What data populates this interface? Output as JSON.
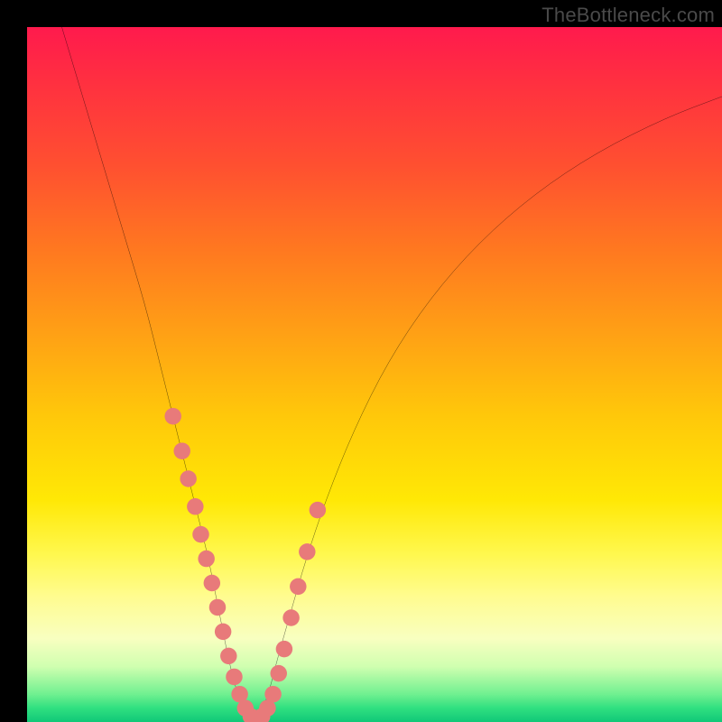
{
  "watermark": "TheBottleneck.com",
  "chart_data": {
    "type": "line",
    "title": "",
    "xlabel": "",
    "ylabel": "",
    "xlim": [
      0,
      100
    ],
    "ylim": [
      0,
      100
    ],
    "grid": false,
    "legend": false,
    "series": [
      {
        "name": "bottleneck-curve",
        "color": "#000000",
        "x": [
          5,
          8,
          11,
          14,
          17,
          19,
          21,
          23,
          24.5,
          26,
          27,
          28,
          29,
          30,
          31,
          32,
          33,
          34,
          35,
          36,
          38,
          40,
          43,
          47,
          52,
          58,
          65,
          73,
          82,
          92,
          100
        ],
        "y": [
          100,
          90,
          80,
          70,
          60,
          52,
          44,
          36,
          30,
          24,
          19,
          14,
          9,
          5,
          2,
          0.5,
          0.5,
          2,
          5,
          9,
          16,
          23,
          32,
          42,
          52,
          61,
          69,
          76,
          82,
          87,
          90
        ]
      },
      {
        "name": "highlight-points",
        "color": "#e87a7a",
        "type": "scatter",
        "x": [
          21,
          22.3,
          23.2,
          24.2,
          25,
          25.8,
          26.6,
          27.4,
          28.2,
          29,
          29.8,
          30.6,
          31.4,
          32.2,
          33,
          33.8,
          34.6,
          35.4,
          36.2,
          37,
          38,
          39,
          40.3,
          41.8
        ],
        "y": [
          44,
          39,
          35,
          31,
          27,
          23.5,
          20,
          16.5,
          13,
          9.5,
          6.5,
          4,
          2,
          0.8,
          0.5,
          0.8,
          2,
          4,
          7,
          10.5,
          15,
          19.5,
          24.5,
          30.5
        ]
      }
    ],
    "background_gradient": {
      "top": "#ff1a4d",
      "mid": "#ffe805",
      "bottom": "#10c878"
    }
  }
}
